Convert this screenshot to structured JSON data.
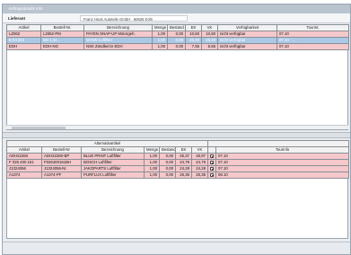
{
  "window": {
    "title": "Auftragsdetails Info"
  },
  "supplier": {
    "label": "Lieferant",
    "value": "Franz Hoos Autoteile GmbH · 60625 Köln"
  },
  "top_table": {
    "columns": [
      "Artikel",
      "Bestell-Nr.",
      "Bezeichnung",
      "Menge",
      "Bestand",
      "EK",
      "VK",
      "Verfügbarkeit",
      "Tourint."
    ],
    "rows": [
      {
        "cells": [
          "LZ062",
          "L2062-PM",
          "PAYEN SNAP-UP Motorgeh.",
          "1,00",
          "0,00",
          "10,60",
          "10,60",
          "nicht verfügbar",
          "07.10"
        ],
        "style": "pink"
      },
      {
        "cells": [
          "B 93 562",
          "BD 1,34...",
          "MANN Luftfilter",
          "1,00",
          "0,00",
          "25,48",
          "25,48",
          "nicht verfügbar",
          "07.10 · ..."
        ],
        "style": "selected"
      },
      {
        "cells": [
          "EDH",
          "EDH-NG",
          "NSK Zündkerze EDH",
          "1,00",
          "0,00",
          "7,55",
          "5,55",
          "nicht verfügbar",
          "07.10"
        ],
        "style": "pink"
      }
    ]
  },
  "bottom_table": {
    "header_title": "Alternativartikel",
    "columns": [
      "Artikel",
      "Bestell-Nr",
      "Bezeichnung",
      "Menge",
      "Bestand",
      "EK",
      "VK",
      "",
      "Tourinfo"
    ],
    "rows": [
      {
        "cells": [
          "ADH22260",
          "ADH22260-BP",
          "BLUE PRINT Luftfilter",
          "1,00",
          "0,00",
          "25,37",
          "25,97",
          "",
          "07.10"
        ],
        "style": "pink"
      },
      {
        "cells": [
          "F 026 400 161",
          "F026400161BH",
          "BOSCH Luftfilter",
          "1,00",
          "0,00",
          "24,79",
          "24,79",
          "",
          "07.10"
        ],
        "style": "pink"
      },
      {
        "cells": [
          "J1324056",
          "J1324056-NI",
          "JAKOPARTS Luftfilter",
          "1,00",
          "0,00",
          "24,28",
          "24,28",
          "",
          "07.10"
        ],
        "style": "pink"
      },
      {
        "cells": [
          "A1374",
          "A1374-PF",
          "PURFLUX Luftfilter",
          "1,00",
          "0,00",
          "26,36",
          "26,36",
          "",
          "08.10"
        ],
        "style": "pink"
      }
    ]
  },
  "status": {
    "left": "",
    "middle": "",
    "right": ""
  },
  "icons": {
    "row_action": "flag-icon"
  }
}
